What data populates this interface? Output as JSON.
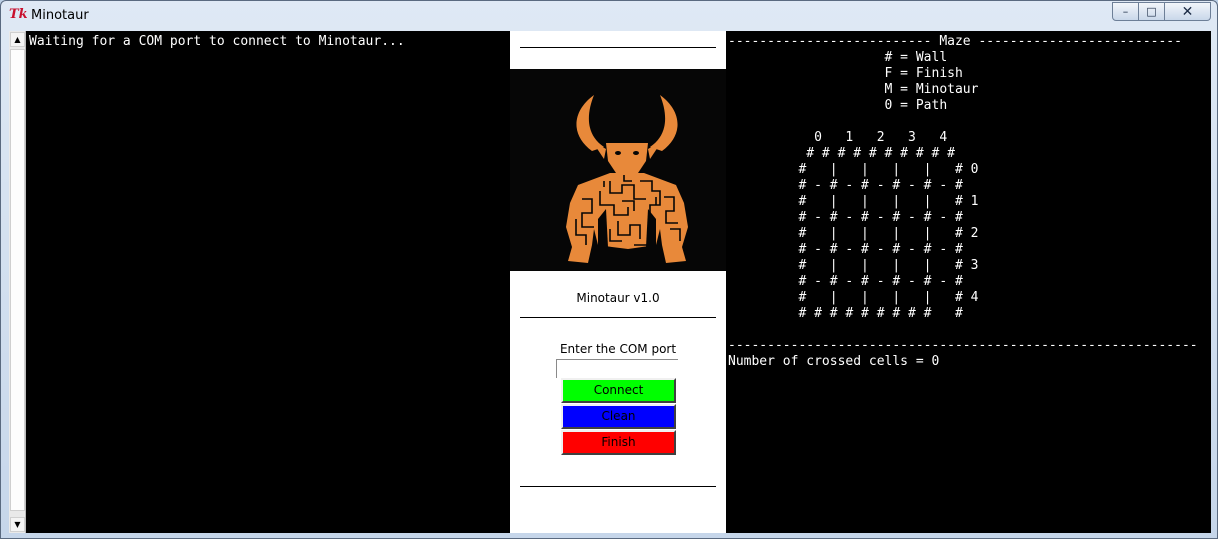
{
  "window": {
    "title": "Minotaur",
    "icon": "tk-feather-icon",
    "controls": {
      "minimize": "–",
      "maximize": "□",
      "close": "✕"
    }
  },
  "console": {
    "text": "Waiting for a COM port to connect to Minotaur..."
  },
  "center_panel": {
    "logo": "minotaur-maze-logo",
    "logo_colors": {
      "background": "#060606",
      "figure": "#e8893a"
    },
    "version": "Minotaur v1.0",
    "com_label": "Enter the COM port",
    "com_value": "",
    "buttons": {
      "connect": {
        "label": "Connect",
        "color": "#00ff00"
      },
      "clean": {
        "label": "Clean",
        "color": "#0000ff"
      },
      "finish": {
        "label": "Finish",
        "color": "#ff0000"
      }
    }
  },
  "maze_panel": {
    "header": "-------------------------- Maze --------------------------",
    "legend": [
      "                    # = Wall",
      "                    F = Finish",
      "                    M = Minotaur",
      "                    0 = Path"
    ],
    "blank": "",
    "maze_lines": [
      "           0   1   2   3   4",
      "          # # # # # # # # # #",
      "         #   |   |   |   |   # 0",
      "         # - # - # - # - # - #",
      "         #   |   |   |   |   # 1",
      "         # - # - # - # - # - #",
      "         #   |   |   |   |   # 2",
      "         # - # - # - # - # - #",
      "         #   |   |   |   |   # 3",
      "         # - # - # - # - # - #",
      "         #   |   |   |   |   # 4",
      "         # # # # # # # # #   #"
    ],
    "footer_rule": "------------------------------------------------------------",
    "crossed_cells": "Number of crossed cells = 0"
  },
  "scrollbar": {
    "up_arrow": "▲",
    "down_arrow": "▼"
  }
}
